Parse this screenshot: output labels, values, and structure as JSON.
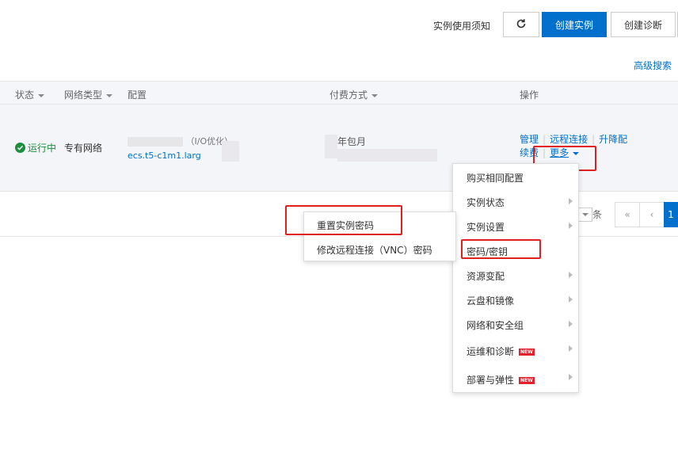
{
  "toolbar": {
    "notice": "实例使用须知",
    "refresh_icon": "refresh-icon",
    "create_instance": "创建实例",
    "create_diagnosis": "创建诊断",
    "advanced_search": "高级搜索",
    "primary_color": "#0070cc"
  },
  "table": {
    "columns": {
      "status": "状态",
      "network_type": "网络类型",
      "config": "配置",
      "payment": "付费方式",
      "actions": "操作"
    },
    "row": {
      "status": "运行中",
      "status_color": "#1e8e3e",
      "network_type": "专有网络",
      "config_line1": "（I/O优化）",
      "config_line2": "ecs.t5-c1m1.larg",
      "payment": "年包月",
      "actions": {
        "manage": "管理",
        "remote": "远程连接",
        "upgrade": "升降配",
        "renew": "续费",
        "more": "更多"
      }
    }
  },
  "pagination": {
    "suffix": "条",
    "first": "«",
    "prev": "‹",
    "current": "1"
  },
  "more_menu": {
    "items": [
      {
        "label": "购买相同配置",
        "has_submenu": false,
        "new": false
      },
      {
        "label": "实例状态",
        "has_submenu": true,
        "new": false
      },
      {
        "label": "实例设置",
        "has_submenu": true,
        "new": false
      },
      {
        "label": "密码/密钥",
        "has_submenu": false,
        "new": false
      },
      {
        "label": "资源变配",
        "has_submenu": true,
        "new": false
      },
      {
        "label": "云盘和镜像",
        "has_submenu": true,
        "new": false
      },
      {
        "label": "网络和安全组",
        "has_submenu": true,
        "new": false
      },
      {
        "label": "运维和诊断",
        "has_submenu": true,
        "new": true
      },
      {
        "label": "部署与弹性",
        "has_submenu": true,
        "new": true
      }
    ],
    "new_badge": "NEW"
  },
  "password_submenu": {
    "items": [
      {
        "label": "重置实例密码"
      },
      {
        "label": "修改远程连接（VNC）密码"
      }
    ]
  },
  "highlight_color": "#e02020"
}
